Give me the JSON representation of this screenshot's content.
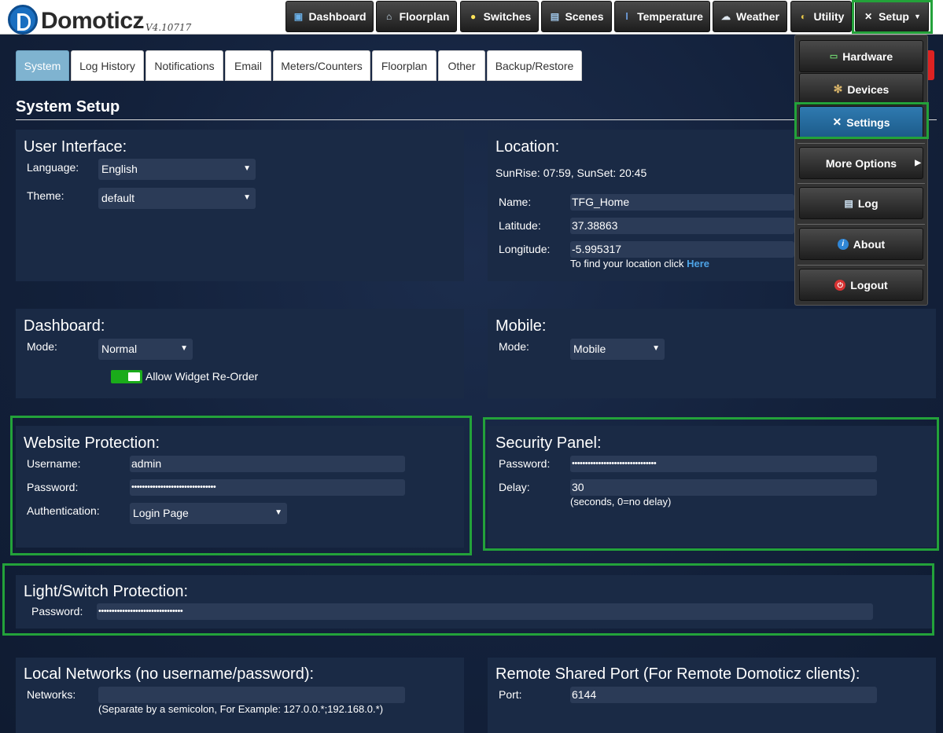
{
  "app": {
    "name": "Domoticz",
    "version": "V4.10717"
  },
  "nav": [
    {
      "label": "Dashboard",
      "icon": "dashboard-icon"
    },
    {
      "label": "Floorplan",
      "icon": "floorplan-icon"
    },
    {
      "label": "Switches",
      "icon": "lightbulb-icon"
    },
    {
      "label": "Scenes",
      "icon": "clapperboard-icon"
    },
    {
      "label": "Temperature",
      "icon": "thermometer-icon"
    },
    {
      "label": "Weather",
      "icon": "cloud-icon"
    },
    {
      "label": "Utility",
      "icon": "utility-icon"
    },
    {
      "label": "Setup",
      "icon": "wrench-icon"
    }
  ],
  "tabs": [
    "System",
    "Log History",
    "Notifications",
    "Email",
    "Meters/Counters",
    "Floorplan",
    "Other",
    "Backup/Restore"
  ],
  "page_title": "System Setup",
  "user_interface": {
    "title": "User Interface:",
    "language_label": "Language:",
    "language_value": "English",
    "theme_label": "Theme:",
    "theme_value": "default"
  },
  "location": {
    "title": "Location:",
    "sun": "SunRise: 07:59, SunSet: 20:45",
    "name_label": "Name:",
    "name_value": "TFG_Home",
    "lat_label": "Latitude:",
    "lat_value": "37.38863",
    "lon_label": "Longitude:",
    "lon_value": "-5.995317",
    "find_text": "To find your location click ",
    "find_link": "Here"
  },
  "dashboard": {
    "title": "Dashboard:",
    "mode_label": "Mode:",
    "mode_value": "Normal",
    "widget_label": "Allow Widget Re-Order",
    "widget_enabled": true
  },
  "mobile": {
    "title": "Mobile:",
    "mode_label": "Mode:",
    "mode_value": "Mobile"
  },
  "website_protection": {
    "title": "Website Protection:",
    "username_label": "Username:",
    "username_value": "admin",
    "password_label": "Password:",
    "password_value": "••••••••••••••••••••••••••••••••",
    "auth_label": "Authentication:",
    "auth_value": "Login Page"
  },
  "security_panel": {
    "title": "Security Panel:",
    "password_label": "Password:",
    "password_value": "••••••••••••••••••••••••••••••••",
    "delay_label": "Delay:",
    "delay_value": "30",
    "delay_note": "(seconds, 0=no delay)"
  },
  "light_switch_protection": {
    "title": "Light/Switch Protection:",
    "password_label": "Password:",
    "password_value": "••••••••••••••••••••••••••••••••"
  },
  "local_networks": {
    "title": "Local Networks (no username/password):",
    "networks_label": "Networks:",
    "networks_value": "",
    "note": "(Separate by a semicolon, For Example: 127.0.0.*;192.168.0.*)"
  },
  "remote_port": {
    "title": "Remote Shared Port (For Remote Domoticz clients):",
    "port_label": "Port:",
    "port_value": "6144"
  },
  "setup_menu": [
    {
      "label": "Hardware",
      "icon": "hardware-icon"
    },
    {
      "label": "Devices",
      "icon": "gear-icon"
    },
    {
      "label": "Settings",
      "icon": "wrench-icon"
    },
    {
      "label": "More Options",
      "icon": "chevron-right-icon"
    },
    {
      "label": "Log",
      "icon": "log-icon"
    },
    {
      "label": "About",
      "icon": "info-icon"
    },
    {
      "label": "Logout",
      "icon": "power-icon"
    }
  ],
  "colors": {
    "highlight": "#23a23a",
    "active_tab": "#7fb3d0",
    "active_menu": "#2f7ab0",
    "link": "#4da3e6"
  }
}
